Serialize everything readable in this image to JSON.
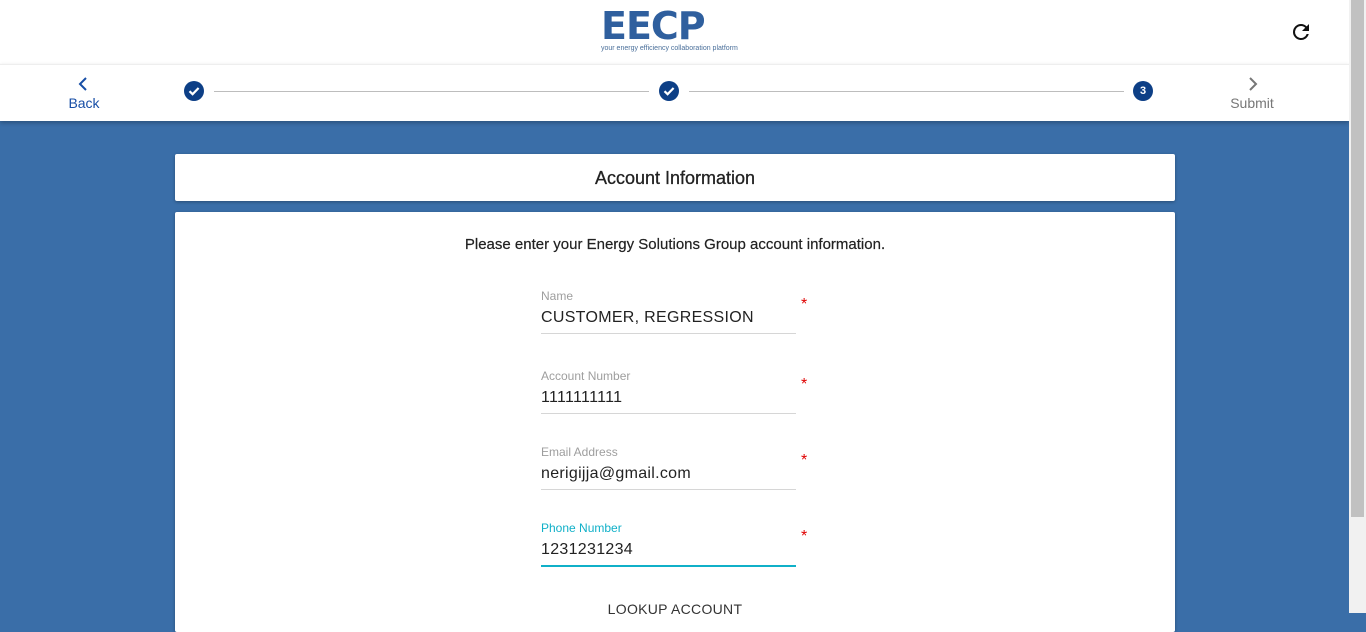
{
  "header": {
    "logo_text": "EECP",
    "logo_tagline": "your energy efficiency collaboration platform",
    "refresh_icon": "refresh-icon"
  },
  "stepper": {
    "back_label": "Back",
    "submit_label": "Submit",
    "steps": [
      {
        "state": "complete",
        "icon": "check-icon"
      },
      {
        "state": "complete",
        "icon": "check-icon"
      },
      {
        "state": "active",
        "label": "3"
      }
    ]
  },
  "page": {
    "title": "Account Information",
    "intro": "Please enter your Energy Solutions Group account information."
  },
  "form": {
    "required_marker": "*",
    "name_label": "Name",
    "name_value": "CUSTOMER, REGRESSION",
    "account_label": "Account Number",
    "account_value": "1111111111",
    "email_label": "Email Address",
    "email_value": "nerigijja@gmail.com",
    "phone_label": "Phone Number",
    "phone_value": "1231231234",
    "lookup_label": "LOOKUP ACCOUNT"
  },
  "colors": {
    "background": "#3a6ea8",
    "primary": "#0d3f86",
    "focus": "#10b0c8",
    "required": "#e00000"
  }
}
